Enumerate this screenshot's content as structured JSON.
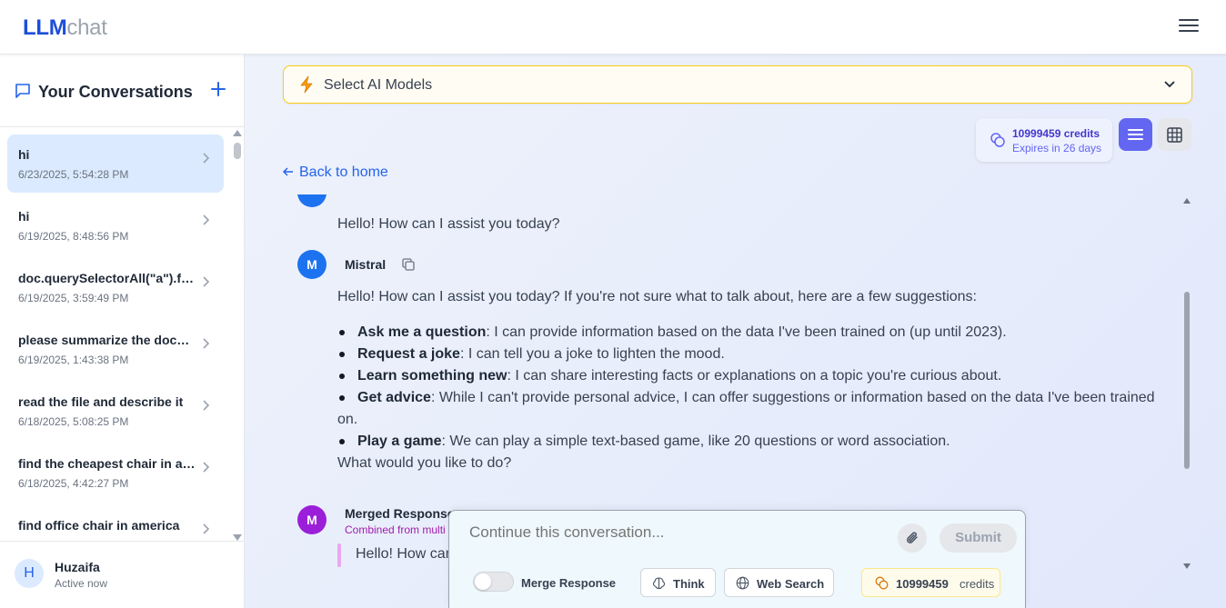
{
  "app": {
    "logo_strong": "LLM",
    "logo_light": "chat"
  },
  "sidebar": {
    "title": "Your Conversations",
    "conversations": [
      {
        "title": "hi",
        "date": "6/23/2025, 5:54:28 PM"
      },
      {
        "title": "hi",
        "date": "6/19/2025, 8:48:56 PM"
      },
      {
        "title": "doc.querySelectorAll(\"a\").for...",
        "date": "6/19/2025, 3:59:49 PM"
      },
      {
        "title": "please summarize the docum...",
        "date": "6/19/2025, 1:43:38 PM"
      },
      {
        "title": "read the file and describe it",
        "date": "6/18/2025, 5:08:25 PM"
      },
      {
        "title": "find the cheapest chair in am...",
        "date": "6/18/2025, 4:42:27 PM"
      },
      {
        "title": "find office chair in america",
        "date": ""
      }
    ],
    "user": {
      "initial": "H",
      "name": "Huzaifa",
      "status": "Active now"
    }
  },
  "toolbar": {
    "model_select_label": "Select AI Models",
    "credits_amount": "10999459 credits",
    "credits_expiry": "Expires in 26 days",
    "back_label": "Back to home"
  },
  "messages": {
    "first_reply": "Hello! How can I assist you today?",
    "mistral": {
      "avatar": "M",
      "name": "Mistral",
      "intro": "Hello! How can I assist you today? If you're not sure what to talk about, here are a few suggestions:",
      "bullets": [
        {
          "bold": "Ask me a question",
          "text": ": I can provide information based on the data I've been trained on (up until 2023)."
        },
        {
          "bold": "Request a joke",
          "text": ": I can tell you a joke to lighten the mood."
        },
        {
          "bold": "Learn something new",
          "text": ": I can share interesting facts or explanations on a topic you're curious about."
        },
        {
          "bold": "Get advice",
          "text": ": While I can't provide personal advice, I can offer suggestions or information based on the data I've been trained on."
        },
        {
          "bold": "Play a game",
          "text": ": We can play a simple text-based game, like 20 questions or word association."
        }
      ],
      "outro": "What would you like to do?"
    },
    "merged": {
      "avatar": "M",
      "name": "Merged Response",
      "subtitle": "Combined from multi",
      "text": "Hello! How can"
    }
  },
  "composer": {
    "placeholder": "Continue this conversation...",
    "submit_label": "Submit",
    "merge_label": "Merge Response",
    "think_label": "Think",
    "web_search_label": "Web Search",
    "credits_number": "10999459",
    "credits_unit": "credits"
  },
  "colors": {
    "accent": "#6366f1",
    "link": "#2563eb",
    "avatar_blue": "#1d72f0",
    "avatar_purple": "#9b1fd8",
    "select_border": "#facc15"
  }
}
